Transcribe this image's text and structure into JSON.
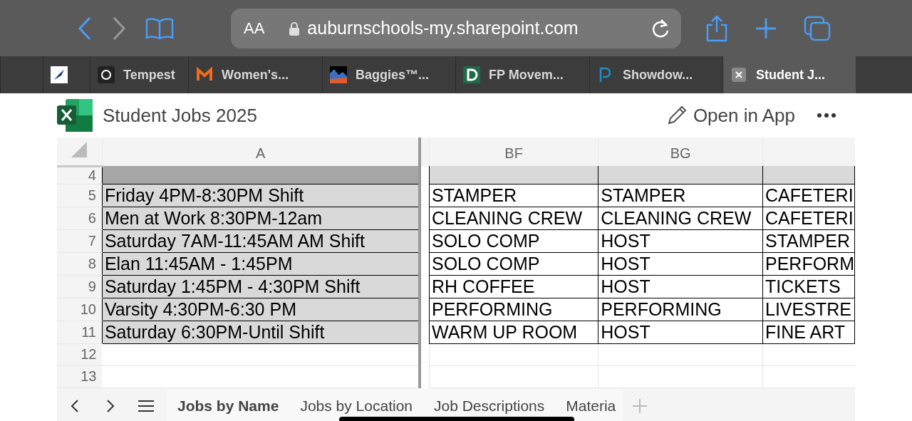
{
  "browser": {
    "text_size_button": "AA",
    "address": "auburnschools-my.sharepoint.com",
    "tabs": [
      {
        "selected": false
      },
      {
        "selected": false
      },
      {
        "title": "Tempest",
        "selected": false
      },
      {
        "title": "Women's...",
        "selected": false
      },
      {
        "title": "Baggies™...",
        "selected": false
      },
      {
        "title": "FP Movem...",
        "selected": false
      },
      {
        "title": "Showdow...",
        "selected": false
      },
      {
        "title": "Student J...",
        "selected": true
      }
    ]
  },
  "app": {
    "title": "Student Jobs 2025",
    "open_button": "Open in App"
  },
  "sheet": {
    "columns": [
      {
        "label": "A",
        "kind": "frozen"
      },
      {
        "kind": "spacer"
      },
      {
        "label": "BF",
        "kind": "data"
      },
      {
        "label": "BG",
        "kind": "data"
      },
      {
        "kind": "data"
      }
    ],
    "rows": [
      {
        "number": "4",
        "kind": "header"
      },
      {
        "number": "5",
        "kind": "data",
        "cells": [
          "Friday 4PM-8:30PM Shift",
          "",
          "STAMPER",
          "STAMPER",
          "CAFETERI"
        ]
      },
      {
        "number": "6",
        "kind": "data",
        "cells": [
          "Men at Work 8:30PM-12am",
          "",
          "CLEANING CREW",
          "CLEANING CREW",
          "CAFETERI"
        ]
      },
      {
        "number": "7",
        "kind": "data",
        "cells": [
          "Saturday 7AM-11:45AM AM Shift",
          "",
          "SOLO COMP",
          "HOST",
          "STAMPER"
        ]
      },
      {
        "number": "8",
        "kind": "data",
        "cells": [
          "Elan 11:45AM - 1:45PM",
          "",
          "SOLO COMP",
          "HOST",
          "PERFORM"
        ]
      },
      {
        "number": "9",
        "kind": "data",
        "cells": [
          "Saturday 1:45PM - 4:30PM Shift",
          "",
          "RH COFFEE",
          "HOST",
          "TICKETS"
        ]
      },
      {
        "number": "10",
        "kind": "data",
        "cells": [
          "Varsity 4:30PM-6:30 PM",
          "",
          "PERFORMING",
          "PERFORMING",
          "LIVESTRE"
        ]
      },
      {
        "number": "11",
        "kind": "data",
        "cells": [
          "Saturday 6:30PM-Until Shift",
          "",
          "WARM UP ROOM",
          "HOST",
          "FINE ART"
        ]
      },
      {
        "number": "12",
        "kind": "empty"
      },
      {
        "number": "13",
        "kind": "empty"
      }
    ],
    "sheet_tabs": [
      {
        "label": "Jobs by Name",
        "selected": true
      },
      {
        "label": "Jobs by Location",
        "selected": false
      },
      {
        "label": "Job Descriptions",
        "selected": false
      },
      {
        "label": "Materia",
        "selected": false
      }
    ]
  }
}
